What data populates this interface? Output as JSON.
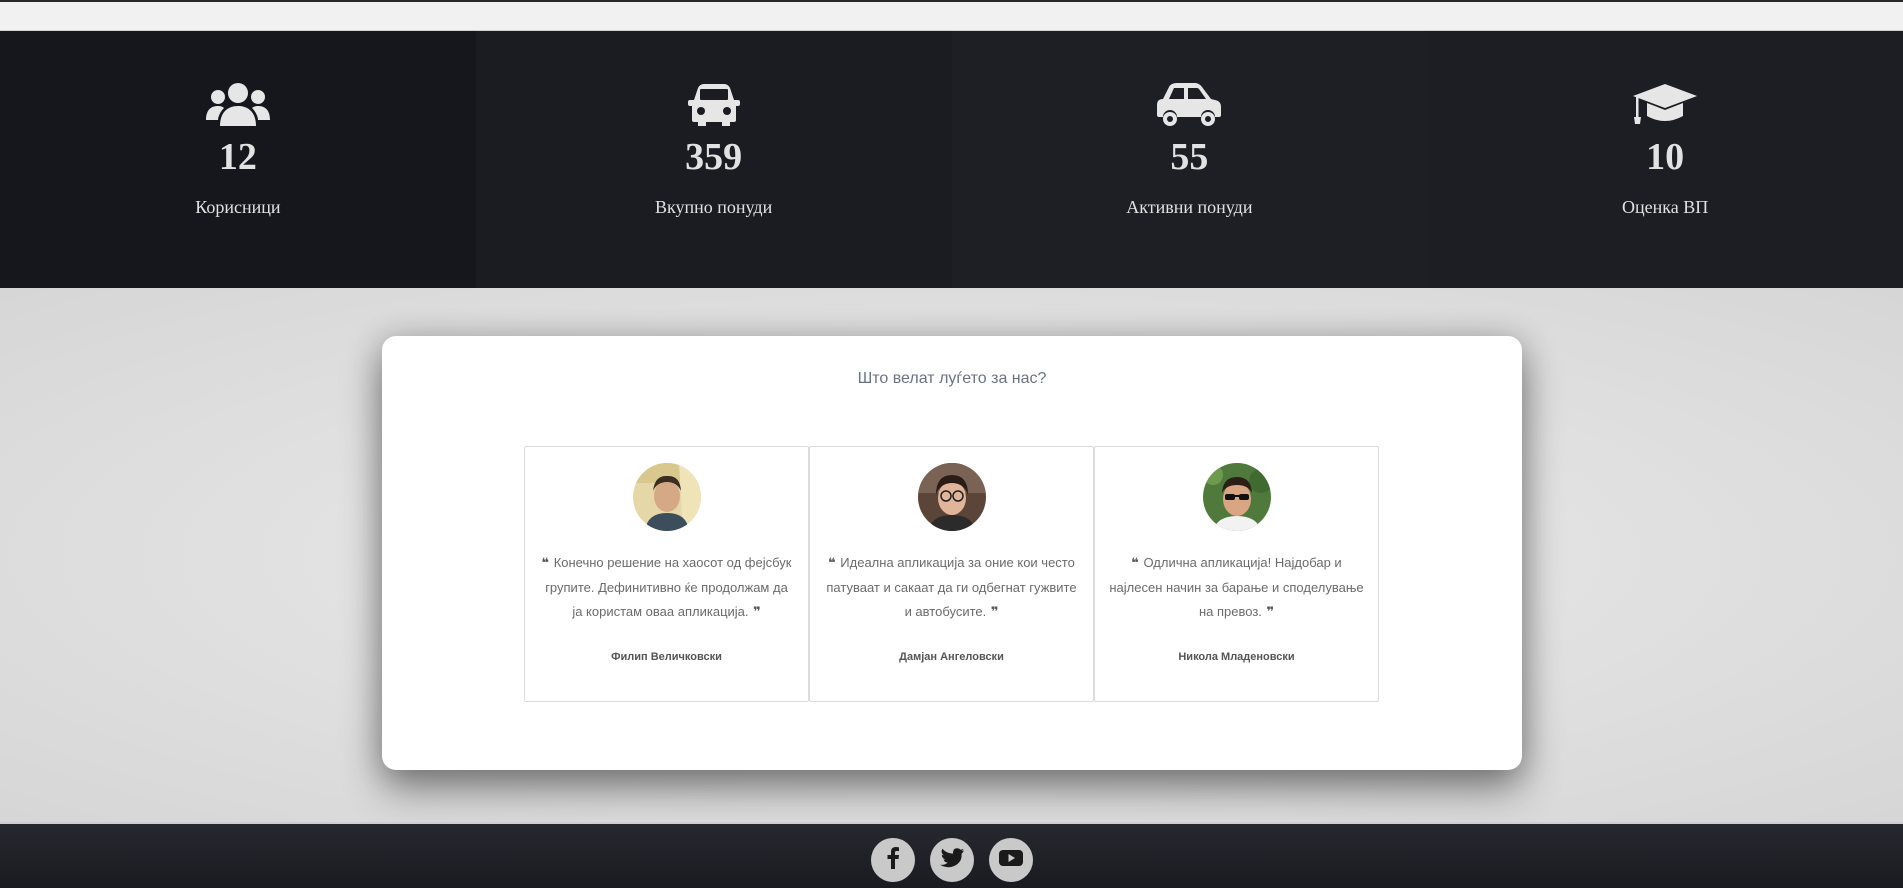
{
  "stats": [
    {
      "icon": "users-icon",
      "value": "12",
      "label": "Корисници"
    },
    {
      "icon": "car-front-icon",
      "value": "359",
      "label": "Вкупно понуди"
    },
    {
      "icon": "car-side-icon",
      "value": "55",
      "label": "Активни понуди"
    },
    {
      "icon": "graduation-cap-icon",
      "value": "10",
      "label": "Оценка ВП"
    }
  ],
  "testimonials": {
    "title": "Што велат луѓето за нас?",
    "items": [
      {
        "text": "Конечно решение на хаосот од фејсбук групите. Дефинитивно ќе продолжам да ја користам оваа апликација.",
        "author": "Филип Величковски",
        "avatar": "avatar-photo-1"
      },
      {
        "text": "Идеална апликација за оние кои често патуваат и сакаат да ги одбегнат гужвите и автобусите.",
        "author": "Дамјан Ангеловски",
        "avatar": "avatar-photo-2"
      },
      {
        "text": "Одлична апликација! Најдобар и најлесен начин за барање и споделување на превоз.",
        "author": "Никола Младеновски",
        "avatar": "avatar-photo-3"
      }
    ]
  },
  "footer": {
    "social": [
      "facebook-icon",
      "twitter-icon",
      "youtube-icon"
    ]
  },
  "colors": {
    "stats_bg": "#1b1c22",
    "stats_text": "#e2e2e2",
    "page_bg": "#dcdcdc",
    "card_bg": "#ffffff",
    "social_bg": "#c9c9c9"
  }
}
